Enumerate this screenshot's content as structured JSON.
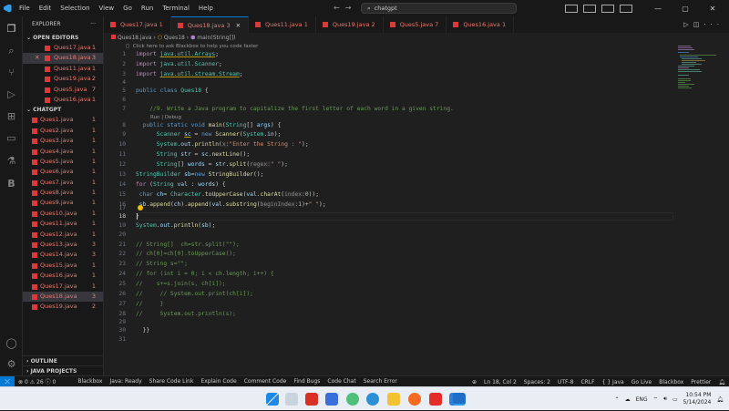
{
  "titlebar": {
    "menu": [
      "File",
      "Edit",
      "Selection",
      "View",
      "Go",
      "Run",
      "Terminal",
      "Help"
    ],
    "search_text": "chatgpt"
  },
  "sidebar": {
    "title": "EXPLORER",
    "open_editors_title": "OPEN EDITORS",
    "open_editors": [
      {
        "name": "Ques17.java",
        "count": "1"
      },
      {
        "name": "Ques18.java",
        "count": "3"
      },
      {
        "name": "Ques11.java",
        "count": "1"
      },
      {
        "name": "Ques19.java",
        "count": "2"
      },
      {
        "name": "Ques5.java",
        "count": "7"
      },
      {
        "name": "Ques16.java",
        "count": "1"
      }
    ],
    "folder_title": "CHATGPT",
    "files": [
      {
        "name": "Ques1.java",
        "count": "1"
      },
      {
        "name": "Ques2.java",
        "count": "1"
      },
      {
        "name": "Ques3.java",
        "count": "1"
      },
      {
        "name": "Ques4.java",
        "count": "1"
      },
      {
        "name": "Ques5.java",
        "count": "1"
      },
      {
        "name": "Ques6.java",
        "count": "1"
      },
      {
        "name": "Ques7.java",
        "count": "1"
      },
      {
        "name": "Ques8.java",
        "count": "1"
      },
      {
        "name": "Ques9.java",
        "count": "1"
      },
      {
        "name": "Ques10.java",
        "count": "1"
      },
      {
        "name": "Ques11.java",
        "count": "1"
      },
      {
        "name": "Ques12.java",
        "count": "1"
      },
      {
        "name": "Ques13.java",
        "count": "3"
      },
      {
        "name": "Ques14.java",
        "count": "3"
      },
      {
        "name": "Ques15.java",
        "count": "1"
      },
      {
        "name": "Ques16.java",
        "count": "1"
      },
      {
        "name": "Ques17.java",
        "count": "1"
      },
      {
        "name": "Ques18.java",
        "count": "3"
      },
      {
        "name": "Ques19.java",
        "count": "2"
      }
    ],
    "outline_title": "OUTLINE",
    "java_projects_title": "JAVA PROJECTS"
  },
  "tabs": [
    {
      "name": "Ques17.java",
      "count": "1"
    },
    {
      "name": "Ques18.java",
      "count": "3"
    },
    {
      "name": "Ques11.java",
      "count": "1"
    },
    {
      "name": "Ques19.java",
      "count": "2"
    },
    {
      "name": "Ques5.java",
      "count": "7"
    },
    {
      "name": "Ques16.java",
      "count": "1"
    }
  ],
  "breadcrumb": {
    "file": "Ques18.java",
    "class": "Ques18",
    "method": "main(String[])"
  },
  "editor": {
    "blackbox_hint": "Click here to ask Blackbox to help you code faster",
    "codelens": "Run | Debug",
    "line_numbers": [
      "1",
      "2",
      "3",
      "4",
      "5",
      "6",
      "7",
      "8",
      "9",
      "10",
      "11",
      "12",
      "13",
      "14",
      "15",
      "16",
      "17",
      "18",
      "19",
      "20",
      "21",
      "22",
      "23",
      "24",
      "25",
      "26",
      "27",
      "28",
      "29",
      "30",
      "31"
    ],
    "current_line": "18"
  },
  "status": {
    "errors": "0",
    "warnings": "26",
    "info": "0",
    "items_left": [
      "Blackbox",
      "Java: Ready",
      "Share Code Link",
      "Explain Code",
      "Comment Code",
      "Find Bugs",
      "Code Chat",
      "Search Error"
    ],
    "items_right": [
      "Ln 18, Col 2",
      "Spaces: 2",
      "UTF-8",
      "CRLF",
      "{ } Java",
      "Go Live",
      "Blackbox",
      "Prettier"
    ]
  },
  "taskbar": {
    "language": "ENG",
    "time": "10:54 PM",
    "date": "5/14/2024"
  }
}
